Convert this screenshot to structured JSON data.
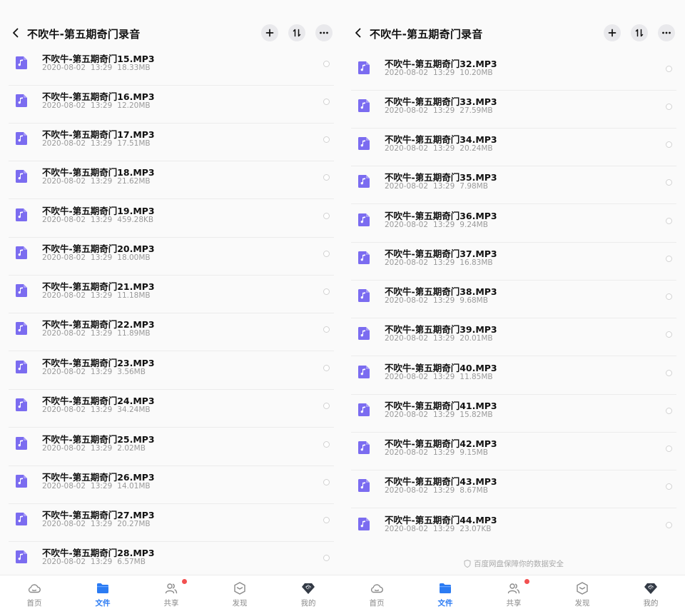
{
  "screens": [
    {
      "header": {
        "title": "不吹牛-第五期奇门录音"
      },
      "files": [
        {
          "name": "不吹牛-第五期奇门15.MP3",
          "date": "2020-08-02",
          "time": "13:29",
          "size": "18.33MB"
        },
        {
          "name": "不吹牛-第五期奇门16.MP3",
          "date": "2020-08-02",
          "time": "13:29",
          "size": "12.20MB"
        },
        {
          "name": "不吹牛-第五期奇门17.MP3",
          "date": "2020-08-02",
          "time": "13:29",
          "size": "17.51MB"
        },
        {
          "name": "不吹牛-第五期奇门18.MP3",
          "date": "2020-08-02",
          "time": "13:29",
          "size": "21.62MB"
        },
        {
          "name": "不吹牛-第五期奇门19.MP3",
          "date": "2020-08-02",
          "time": "13:29",
          "size": "459.28KB"
        },
        {
          "name": "不吹牛-第五期奇门20.MP3",
          "date": "2020-08-02",
          "time": "13:29",
          "size": "18.00MB"
        },
        {
          "name": "不吹牛-第五期奇门21.MP3",
          "date": "2020-08-02",
          "time": "13:29",
          "size": "11.18MB"
        },
        {
          "name": "不吹牛-第五期奇门22.MP3",
          "date": "2020-08-02",
          "time": "13:29",
          "size": "11.89MB"
        },
        {
          "name": "不吹牛-第五期奇门23.MP3",
          "date": "2020-08-02",
          "time": "13:29",
          "size": "3.56MB"
        },
        {
          "name": "不吹牛-第五期奇门24.MP3",
          "date": "2020-08-02",
          "time": "13:29",
          "size": "34.24MB"
        },
        {
          "name": "不吹牛-第五期奇门25.MP3",
          "date": "2020-08-02",
          "time": "13:29",
          "size": "2.02MB"
        },
        {
          "name": "不吹牛-第五期奇门26.MP3",
          "date": "2020-08-02",
          "time": "13:29",
          "size": "14.01MB"
        },
        {
          "name": "不吹牛-第五期奇门27.MP3",
          "date": "2020-08-02",
          "time": "13:29",
          "size": "20.27MB"
        },
        {
          "name": "不吹牛-第五期奇门28.MP3",
          "date": "2020-08-02",
          "time": "13:29",
          "size": "6.57MB"
        }
      ],
      "footer_note": ""
    },
    {
      "header": {
        "title": "不吹牛-第五期奇门录音"
      },
      "files": [
        {
          "name": "不吹牛-第五期奇门32.MP3",
          "date": "2020-08-02",
          "time": "13:29",
          "size": "10.20MB"
        },
        {
          "name": "不吹牛-第五期奇门33.MP3",
          "date": "2020-08-02",
          "time": "13:29",
          "size": "27.59MB"
        },
        {
          "name": "不吹牛-第五期奇门34.MP3",
          "date": "2020-08-02",
          "time": "13:29",
          "size": "20.24MB"
        },
        {
          "name": "不吹牛-第五期奇门35.MP3",
          "date": "2020-08-02",
          "time": "13:29",
          "size": "7.98MB"
        },
        {
          "name": "不吹牛-第五期奇门36.MP3",
          "date": "2020-08-02",
          "time": "13:29",
          "size": "9.24MB"
        },
        {
          "name": "不吹牛-第五期奇门37.MP3",
          "date": "2020-08-02",
          "time": "13:29",
          "size": "16.83MB"
        },
        {
          "name": "不吹牛-第五期奇门38.MP3",
          "date": "2020-08-02",
          "time": "13:29",
          "size": "9.68MB"
        },
        {
          "name": "不吹牛-第五期奇门39.MP3",
          "date": "2020-08-02",
          "time": "13:29",
          "size": "20.01MB"
        },
        {
          "name": "不吹牛-第五期奇门40.MP3",
          "date": "2020-08-02",
          "time": "13:29",
          "size": "11.85MB"
        },
        {
          "name": "不吹牛-第五期奇门41.MP3",
          "date": "2020-08-02",
          "time": "13:29",
          "size": "15.82MB"
        },
        {
          "name": "不吹牛-第五期奇门42.MP3",
          "date": "2020-08-02",
          "time": "13:29",
          "size": "9.15MB"
        },
        {
          "name": "不吹牛-第五期奇门43.MP3",
          "date": "2020-08-02",
          "time": "13:29",
          "size": "8.67MB"
        },
        {
          "name": "不吹牛-第五期奇门44.MP3",
          "date": "2020-08-02",
          "time": "13:29",
          "size": "23.07KB"
        }
      ],
      "footer_note": "百度网盘保障你的数据安全"
    }
  ],
  "tabbar": [
    {
      "label": "首页",
      "icon": "cloud-icon",
      "active": false,
      "badge": false
    },
    {
      "label": "文件",
      "icon": "folder-icon",
      "active": true,
      "badge": false
    },
    {
      "label": "共享",
      "icon": "share-people-icon",
      "active": false,
      "badge": true
    },
    {
      "label": "发现",
      "icon": "discover-box-icon",
      "active": false,
      "badge": false
    },
    {
      "label": "我的",
      "icon": "profile-diamond-icon",
      "active": false,
      "badge": false
    }
  ],
  "colors": {
    "accent": "#2b7bf3",
    "file_icon": "#7b6cf0",
    "badge": "#f25050",
    "meta_text": "#9a9a9a"
  }
}
